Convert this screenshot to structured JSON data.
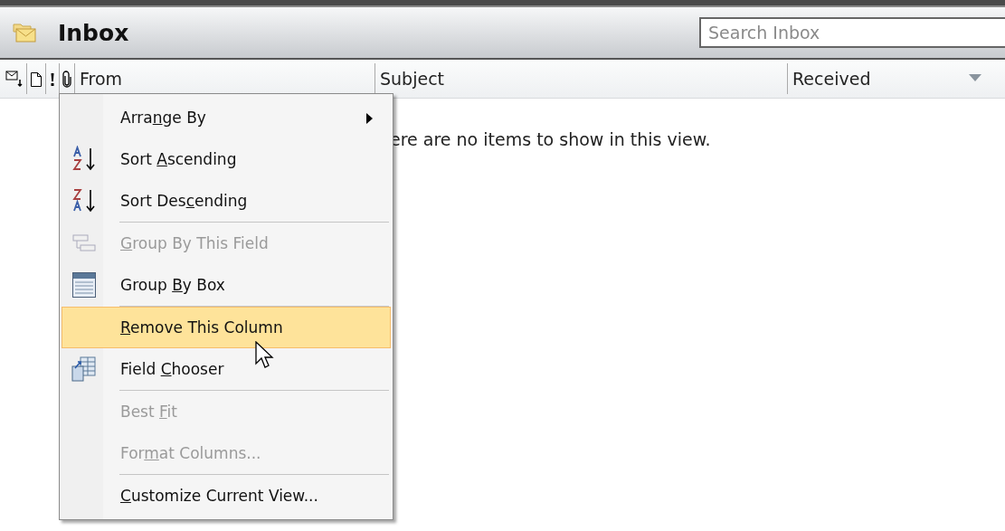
{
  "folder": {
    "title": "Inbox",
    "search": {
      "placeholder": "Search Inbox"
    }
  },
  "columns": [
    {
      "kind": "icon"
    },
    {
      "kind": "icon"
    },
    {
      "kind": "icon"
    },
    {
      "kind": "icon"
    },
    {
      "kind": "text",
      "label": "From"
    },
    {
      "kind": "text",
      "label": "Subject"
    },
    {
      "kind": "text",
      "label": "Received",
      "sorted": true
    }
  ],
  "empty_message": "ere are no items to show in this view.",
  "context_menu": [
    {
      "kind": "item",
      "pre": "Arra",
      "key": "n",
      "post": "ge By",
      "submenu": true,
      "disabled": false,
      "selected": false
    },
    {
      "kind": "item",
      "pre": "Sort ",
      "key": "A",
      "post": "scending",
      "submenu": false,
      "disabled": false,
      "selected": false
    },
    {
      "kind": "item",
      "pre": "Sort Des",
      "key": "c",
      "post": "ending",
      "submenu": false,
      "disabled": false,
      "selected": false
    },
    {
      "kind": "separator"
    },
    {
      "kind": "item",
      "key": "G",
      "post": "roup By This Field",
      "submenu": false,
      "disabled": true,
      "selected": false
    },
    {
      "kind": "item",
      "pre": "Group ",
      "key": "B",
      "post": "y Box",
      "submenu": false,
      "disabled": false,
      "selected": false
    },
    {
      "kind": "separator"
    },
    {
      "kind": "item",
      "key": "R",
      "post": "emove This Column",
      "submenu": false,
      "disabled": false,
      "selected": true
    },
    {
      "kind": "item",
      "pre": "Field ",
      "key": "C",
      "post": "hooser",
      "submenu": false,
      "disabled": false,
      "selected": false
    },
    {
      "kind": "separator"
    },
    {
      "kind": "item",
      "pre": "Best ",
      "key": "F",
      "post": "it",
      "submenu": false,
      "disabled": true,
      "selected": false
    },
    {
      "kind": "item",
      "pre": "For",
      "key": "m",
      "post": "at Columns...",
      "submenu": false,
      "disabled": true,
      "selected": false
    },
    {
      "kind": "separator"
    },
    {
      "kind": "item",
      "key": "C",
      "post": "ustomize Current View...",
      "submenu": false,
      "disabled": false,
      "selected": false
    }
  ]
}
